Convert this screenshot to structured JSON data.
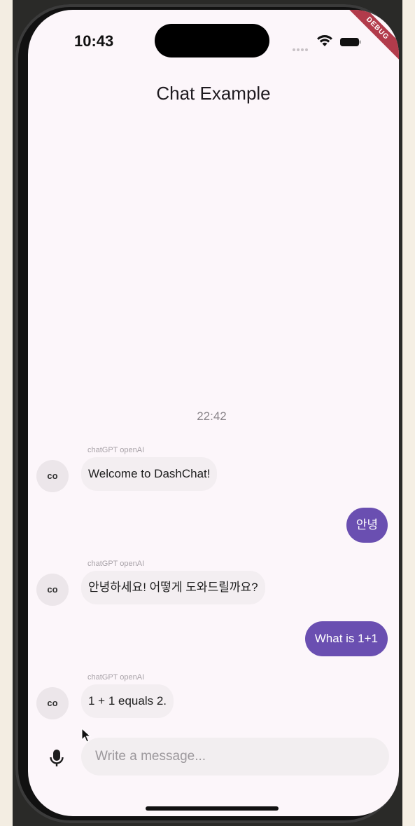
{
  "status_bar": {
    "time": "10:43",
    "debug_label": "DEBUG"
  },
  "app": {
    "title": "Chat Example"
  },
  "chat": {
    "date_separator": "22:42",
    "messages": [
      {
        "direction": "incoming",
        "sender": "chatGPT openAI",
        "avatar_initials": "co",
        "text": "Welcome to DashChat!"
      },
      {
        "direction": "outgoing",
        "text": "안녕"
      },
      {
        "direction": "incoming",
        "sender": "chatGPT openAI",
        "avatar_initials": "co",
        "text": "안녕하세요! 어떻게 도와드릴까요?"
      },
      {
        "direction": "outgoing",
        "text": "What is 1+1"
      },
      {
        "direction": "incoming",
        "sender": "chatGPT openAI",
        "avatar_initials": "co",
        "text": "1 + 1 equals 2."
      }
    ]
  },
  "composer": {
    "placeholder": "Write a message...",
    "value": "",
    "mic_icon": "microphone-icon"
  },
  "colors": {
    "outgoing_bubble": "#6a4fb1",
    "incoming_bubble": "#f3eef1",
    "screen_background": "#fcf6fa"
  }
}
